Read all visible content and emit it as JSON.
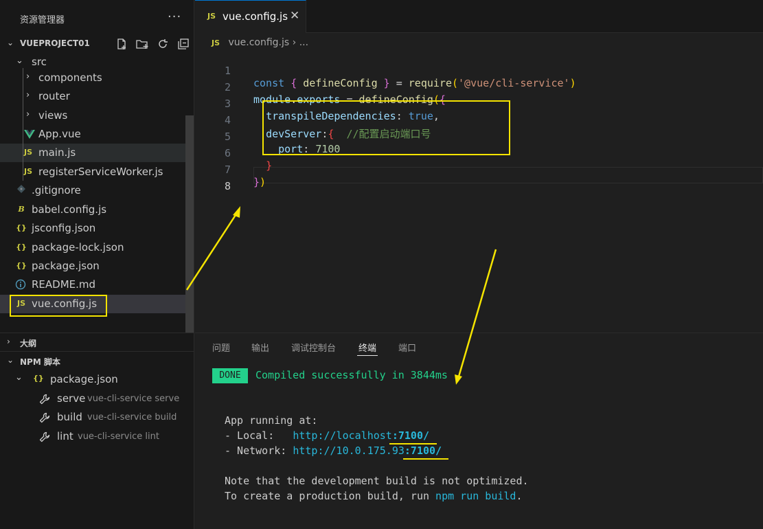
{
  "explorer": {
    "title": "资源管理器",
    "more_icon": "···",
    "project_name": "VUEPROJECT01",
    "tree": {
      "src": "src",
      "components": "components",
      "router": "router",
      "views": "views",
      "app_vue": "App.vue",
      "main_js": "main.js",
      "register_sw": "registerServiceWorker.js",
      "gitignore": ".gitignore",
      "babel_config": "babel.config.js",
      "jsconfig": "jsconfig.json",
      "package_lock": "package-lock.json",
      "package_json": "package.json",
      "readme": "README.md",
      "vue_config": "vue.config.js"
    },
    "outline_label": "大纲",
    "npm_label": "NPM 脚本",
    "npm_package": "package.json",
    "scripts": [
      {
        "name": "serve",
        "command": "vue-cli-service serve"
      },
      {
        "name": "build",
        "command": "vue-cli-service build"
      },
      {
        "name": "lint",
        "command": "vue-cli-service lint"
      }
    ]
  },
  "editor": {
    "tab_label": "vue.config.js",
    "tab_icon": "JS",
    "breadcrumb": "vue.config.js",
    "breadcrumb_sep": "›",
    "breadcrumb_more": "...",
    "line_numbers": [
      "1",
      "2",
      "3",
      "4",
      "5",
      "6",
      "7",
      "8"
    ],
    "code": {
      "l1_kw": "const",
      "l1_ob": "{",
      "l1_id": "defineConfig",
      "l1_cb": "}",
      "l1_eq": "=",
      "l1_fn": "require",
      "l1_op": "(",
      "l1_str": "'@vue/cli-service'",
      "l1_cp": ")",
      "l2_mod": "module",
      "l2_dot": ".",
      "l2_exp": "exports",
      "l2_eq": "=",
      "l2_fn": "defineConfig",
      "l2_op": "(",
      "l2_ob": "{",
      "l3_key": "transpileDependencies",
      "l3_colon": ":",
      "l3_val": "true",
      "l3_comma": ",",
      "l4_key": "devServer",
      "l4_colon": ":",
      "l4_ob": "{",
      "l4_comment": "//配置启动端口号",
      "l5_key": "port",
      "l5_colon": ":",
      "l5_val": "7100",
      "l6_cb": "}",
      "l7_cb": "}",
      "l7_cp": ")"
    }
  },
  "panel": {
    "tabs": [
      "问题",
      "输出",
      "调试控制台",
      "终端",
      "端口"
    ],
    "active_tab": "终端",
    "done_badge": "DONE",
    "compiled": "Compiled successfully in 3844ms",
    "running": "App running at:",
    "local_label": "- Local:   ",
    "local_url_base": "http://localhost",
    "local_url_port": ":7100/",
    "network_label": "- Network: ",
    "network_url_base": "http://10.0.175.93",
    "network_url_port": ":7100/",
    "note1": "Note that the development build is not optimized.",
    "note2_prefix": "To create a production build, run ",
    "note2_cmd": "npm run build",
    "note2_suffix": "."
  },
  "colors": {
    "highlight": "#f5e400",
    "accent": "#0078d4",
    "terminal_green": "#23d18b",
    "terminal_cyan": "#29b8db"
  }
}
